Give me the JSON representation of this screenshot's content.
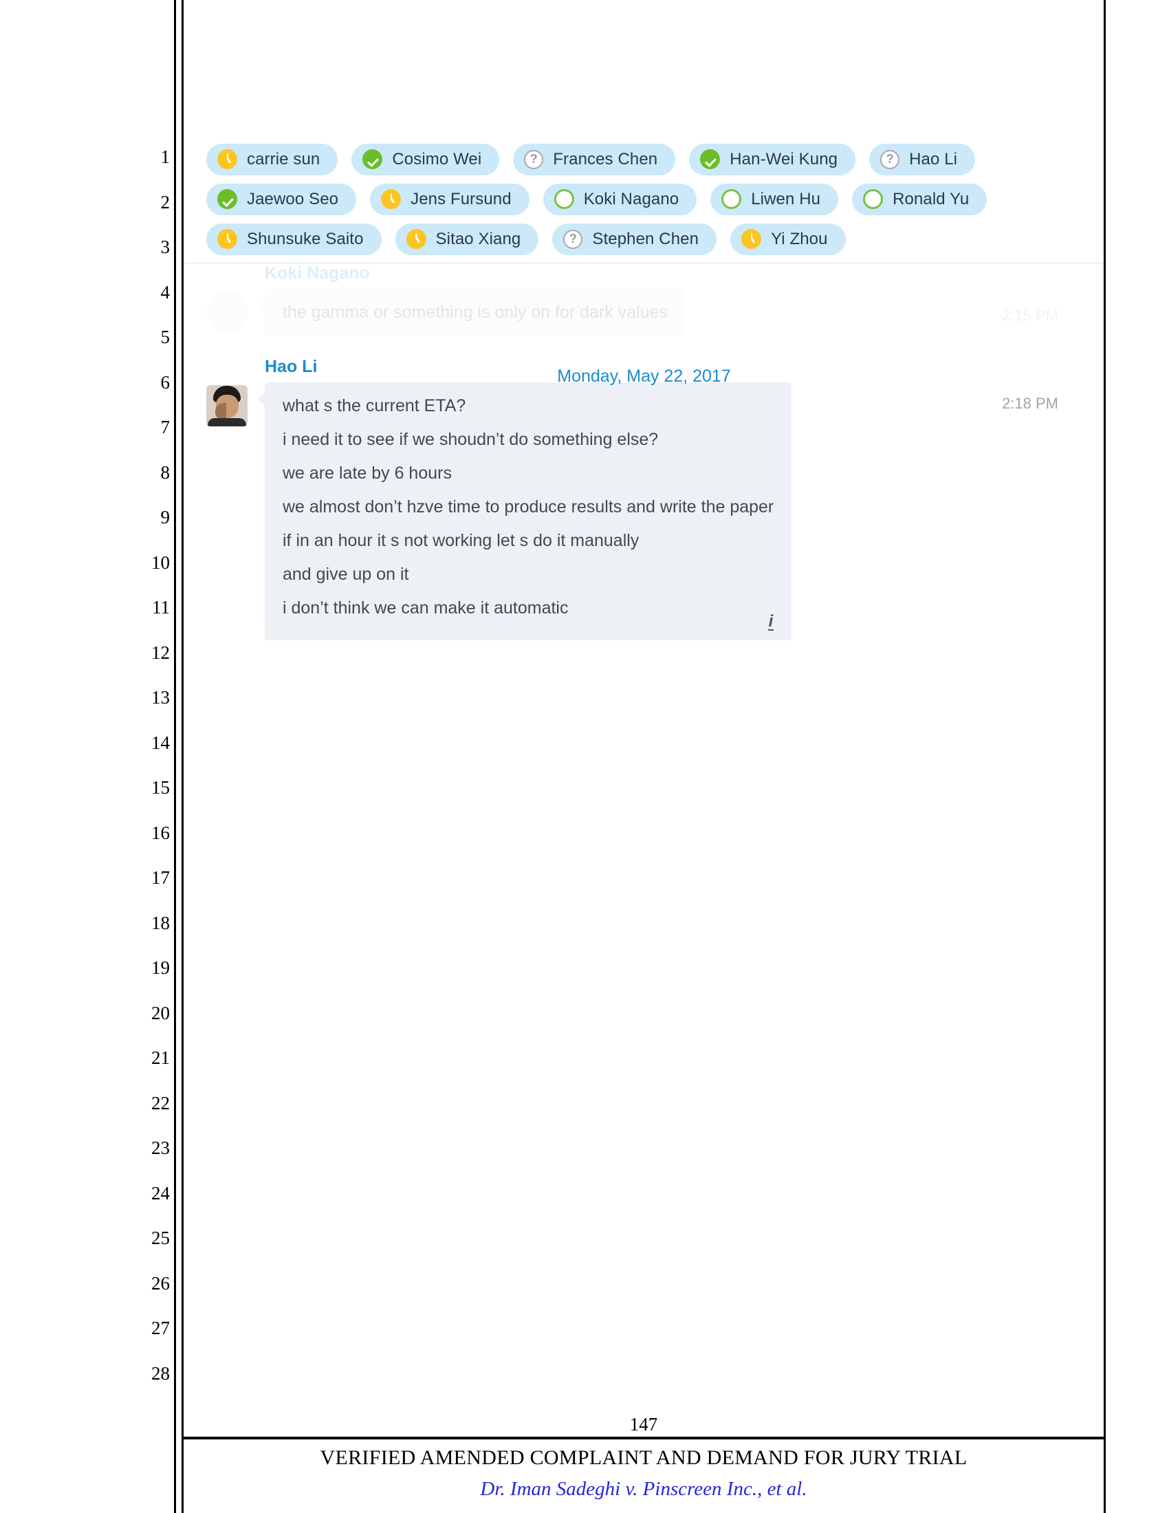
{
  "document": {
    "line_numbers": [
      "1",
      "2",
      "3",
      "4",
      "5",
      "6",
      "7",
      "8",
      "9",
      "10",
      "11",
      "12",
      "13",
      "14",
      "15",
      "16",
      "17",
      "18",
      "19",
      "20",
      "21",
      "22",
      "23",
      "24",
      "25",
      "26",
      "27",
      "28"
    ],
    "page_number": "147",
    "footer_title": "VERIFIED AMENDED COMPLAINT AND DEMAND FOR JURY TRIAL",
    "footer_case": "Dr. Iman Sadeghi v. Pinscreen Inc., et al."
  },
  "chat": {
    "participants": [
      {
        "name": "carrie sun",
        "status": "away",
        "status_icon": "clock-icon"
      },
      {
        "name": "Cosimo Wei",
        "status": "online",
        "status_icon": "check-circle-icon"
      },
      {
        "name": "Frances Chen",
        "status": "unknown",
        "status_icon": "question-circle-icon"
      },
      {
        "name": "Han-Wei Kung",
        "status": "online",
        "status_icon": "check-circle-icon"
      },
      {
        "name": "Hao Li",
        "status": "unknown",
        "status_icon": "question-circle-icon"
      },
      {
        "name": "Jaewoo Seo",
        "status": "online",
        "status_icon": "check-circle-icon"
      },
      {
        "name": "Jens Fursund",
        "status": "away",
        "status_icon": "clock-icon"
      },
      {
        "name": "Koki Nagano",
        "status": "available",
        "status_icon": "circle-outline-icon"
      },
      {
        "name": "Liwen Hu",
        "status": "available",
        "status_icon": "circle-outline-icon"
      },
      {
        "name": "Ronald Yu",
        "status": "available",
        "status_icon": "circle-outline-icon"
      },
      {
        "name": "Shunsuke Saito",
        "status": "away",
        "status_icon": "clock-icon"
      },
      {
        "name": "Sitao Xiang",
        "status": "away",
        "status_icon": "clock-icon"
      },
      {
        "name": "Stephen Chen",
        "status": "unknown",
        "status_icon": "question-circle-icon"
      },
      {
        "name": "Yi Zhou",
        "status": "away",
        "status_icon": "clock-icon"
      }
    ],
    "date_separator": "Monday, May 22, 2017",
    "faded_message": {
      "sender": "Koki Nagano",
      "text": "the gamma or something is only on for dark values",
      "time": "2:15 PM"
    },
    "message": {
      "sender": "Hao Li",
      "time": "2:18 PM",
      "lines": [
        "what s the current ETA?",
        "i need it to see if we shoudn’t do something else?",
        "we are late by 6 hours",
        "we almost don’t hzve time to produce results and write the paper",
        "if in an hour it s not working let s do it manually",
        "and give up on it",
        "i don’t think we can make it automatic"
      ]
    },
    "colors": {
      "chip_background": "#cbe9f8",
      "status_online": "#6cbd29",
      "status_away": "#fcc521",
      "status_available_ring": "#7ac143",
      "status_unknown_ring": "#a9a9a9",
      "sender_name": "#1a8cd0",
      "bubble_background": "#edf1f5"
    }
  }
}
